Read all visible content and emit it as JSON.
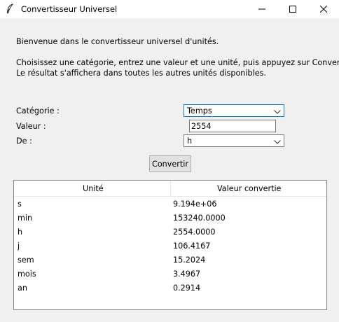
{
  "window": {
    "title": "Convertisseur Universel",
    "icon": "feather-icon"
  },
  "intro": {
    "welcome": "Bienvenue dans le convertisseur universel d'unités.",
    "instructions_line1": "Choisissez une catégorie, entrez une valeur et une unité, puis appuyez sur Convertir.",
    "instructions_line2": "Le résultat s'affichera dans toutes les autres unités disponibles."
  },
  "form": {
    "category_label": "Catégorie :",
    "category_value": "Temps",
    "value_label": "Valeur :",
    "value_input": "2554",
    "from_label": "De :",
    "from_value": "h",
    "convert_button": "Convertir"
  },
  "results": {
    "columns": [
      "Unité",
      "Valeur convertie"
    ],
    "rows": [
      {
        "unit": "s",
        "value": "9.194e+06"
      },
      {
        "unit": "min",
        "value": "153240.0000"
      },
      {
        "unit": "h",
        "value": "2554.0000"
      },
      {
        "unit": "j",
        "value": "106.4167"
      },
      {
        "unit": "sem",
        "value": "15.2024"
      },
      {
        "unit": "mois",
        "value": "3.4967"
      },
      {
        "unit": "an",
        "value": "0.2914"
      }
    ]
  },
  "colors": {
    "focus_border": "#0078d7",
    "window_bg": "#f0f0f0"
  }
}
